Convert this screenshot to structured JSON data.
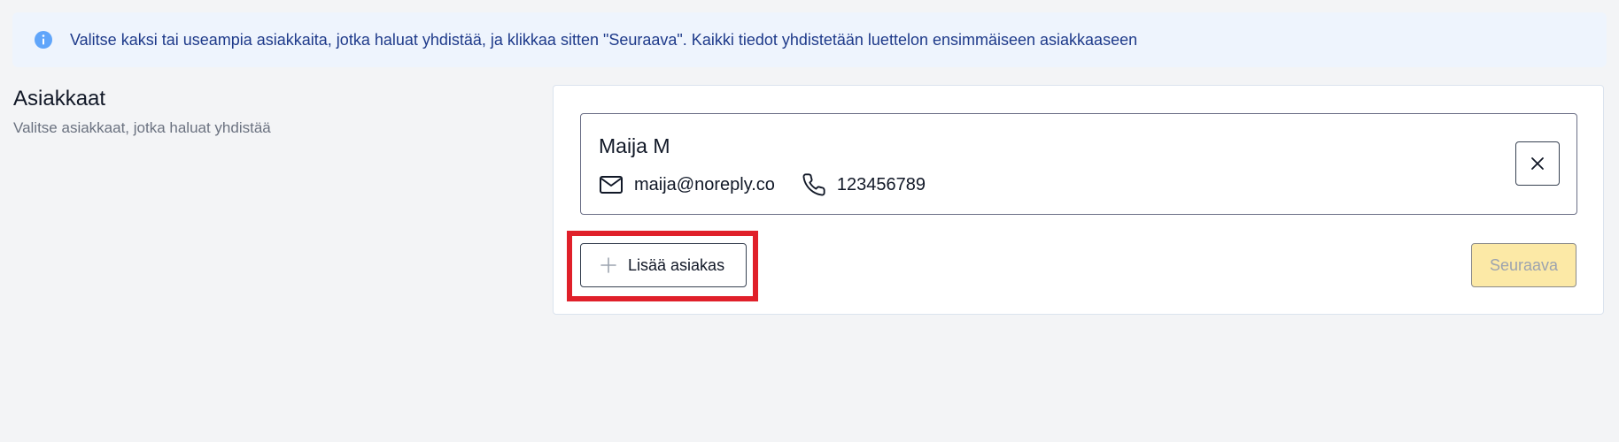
{
  "banner": {
    "icon": "info-icon",
    "text": "Valitse kaksi tai useampia asiakkaita, jotka haluat yhdistää, ja klikkaa sitten \"Seuraava\". Kaikki tiedot yhdistetään luettelon ensimmäiseen asiakkaaseen"
  },
  "section": {
    "title": "Asiakkaat",
    "subtitle": "Valitse asiakkaat, jotka haluat yhdistää"
  },
  "customers": [
    {
      "name": "Maija M",
      "email": "maija@noreply.co",
      "phone": "123456789"
    }
  ],
  "actions": {
    "add_label": "Lisää asiakas",
    "next_label": "Seuraava",
    "next_disabled": true
  },
  "colors": {
    "accent_info": "#60a5fa",
    "highlight": "#e0202a",
    "next_bg": "#fce9a6"
  }
}
